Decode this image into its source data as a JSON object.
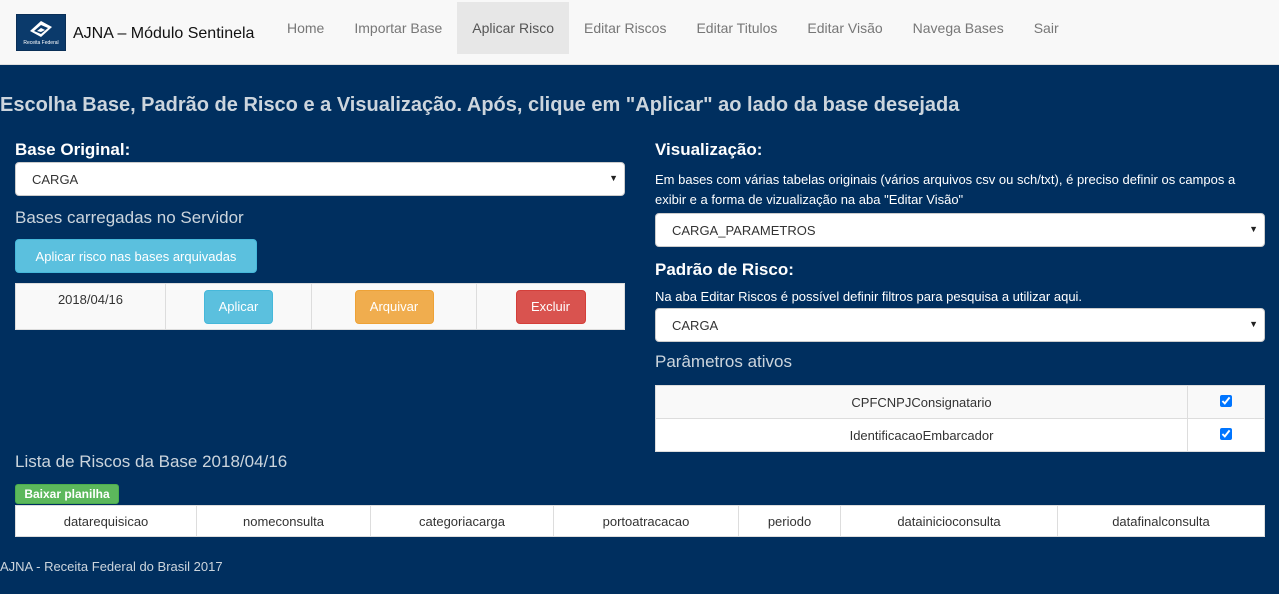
{
  "brand": {
    "title": "AJNA – Módulo Sentinela",
    "logo_text": "Receita Federal",
    "logo_icon": "receita-federal-logo"
  },
  "nav": {
    "items": [
      {
        "label": "Home"
      },
      {
        "label": "Importar Base"
      },
      {
        "label": "Aplicar Risco",
        "active": true
      },
      {
        "label": "Editar Riscos"
      },
      {
        "label": "Editar Titulos"
      },
      {
        "label": "Editar Visão"
      },
      {
        "label": "Navega Bases"
      },
      {
        "label": "Sair"
      }
    ]
  },
  "heading": "Escolha Base, Padrão de Risco e a Visualização. Após, clique em \"Aplicar\" ao lado da base desejada",
  "left": {
    "base_label": "Base Original:",
    "base_value": "CARGA",
    "bases_title": "Bases carregadas no Servidor",
    "apply_archived_label": "Aplicar risco nas bases arquivadas",
    "bases": [
      {
        "date": "2018/04/16",
        "apply_label": "Aplicar",
        "archive_label": "Arquivar",
        "delete_label": "Excluir"
      }
    ]
  },
  "right": {
    "visualizacao_label": "Visualização:",
    "visualizacao_help": "Em bases com várias tabelas originais (vários arquivos csv ou sch/txt), é preciso definir os campos a exibir e a forma de vizualização na aba \"Editar Visão\"",
    "visualizacao_value": "CARGA_PARAMETROS",
    "risco_label": "Padrão de Risco:",
    "risco_help": "Na aba Editar Riscos é possível definir filtros para pesquisa a utilizar aqui.",
    "risco_value": "CARGA",
    "params_title": "Parâmetros ativos",
    "params": [
      {
        "name": "CPFCNPJConsignatario",
        "checked": true
      },
      {
        "name": "IdentificacaoEmbarcador",
        "checked": true
      }
    ]
  },
  "riscos": {
    "title": "Lista de Riscos da Base 2018/04/16",
    "download_label": "Baixar planilha",
    "columns": [
      "datarequisicao",
      "nomeconsulta",
      "categoriacarga",
      "portoatracacao",
      "periodo",
      "datainicioconsulta",
      "datafinalconsulta"
    ]
  },
  "footer": "AJNA - Receita Federal do Brasil 2017"
}
